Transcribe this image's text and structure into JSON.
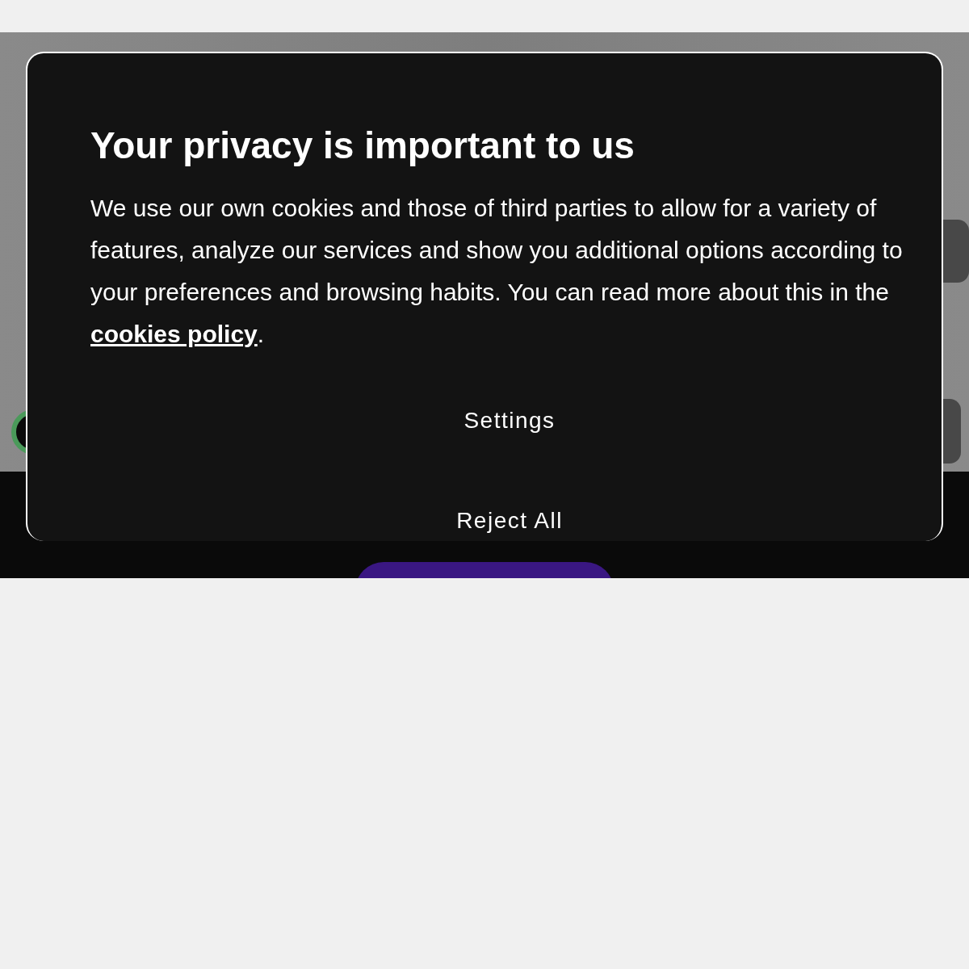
{
  "dialog": {
    "title": "Your privacy is important to us",
    "text_before": "We use our own cookies and those of third parties to allow for a variety of features, analyze our services and show you additional options according to your preferences and browsing habits. You can read more about this in the ",
    "link": "cookies policy",
    "text_after": ".",
    "buttons": [
      {
        "label": "Settings",
        "kind": "text"
      },
      {
        "label": "Reject All",
        "kind": "text"
      }
    ]
  }
}
